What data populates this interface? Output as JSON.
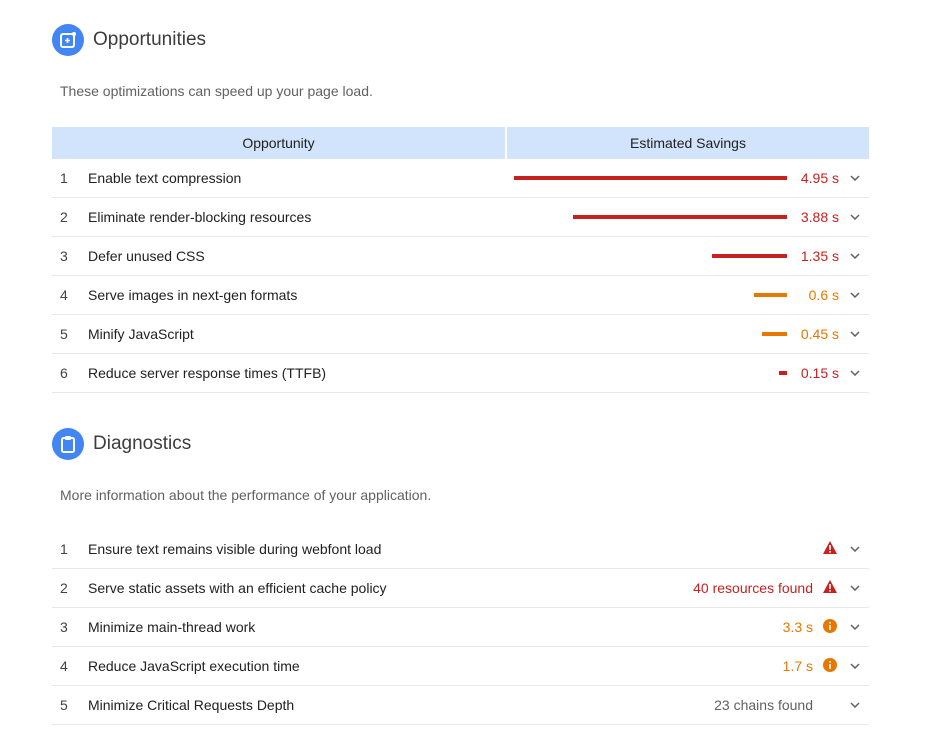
{
  "opportunities": {
    "title": "Opportunities",
    "icon": "sparkle-box-icon",
    "description": "These optimizations can speed up your page load.",
    "headers": [
      "Opportunity",
      "Estimated Savings"
    ],
    "rows": [
      {
        "n": "1",
        "label": "Enable text compression",
        "savings": 4.95,
        "value": "4.95 s",
        "color": "#c5221f"
      },
      {
        "n": "2",
        "label": "Eliminate render-blocking resources",
        "savings": 3.88,
        "value": "3.88 s",
        "color": "#c5221f"
      },
      {
        "n": "3",
        "label": "Defer unused CSS",
        "savings": 1.35,
        "value": "1.35 s",
        "color": "#c5221f"
      },
      {
        "n": "4",
        "label": "Serve images in next-gen formats",
        "savings": 0.6,
        "value": "0.6 s",
        "color": "#e67700"
      },
      {
        "n": "5",
        "label": "Minify JavaScript",
        "savings": 0.45,
        "value": "0.45 s",
        "color": "#e67700"
      },
      {
        "n": "6",
        "label": "Reduce server response times (TTFB)",
        "savings": 0.15,
        "value": "0.15 s",
        "color": "#c5221f"
      }
    ]
  },
  "diagnostics": {
    "title": "Diagnostics",
    "icon": "clipboard-icon",
    "description": "More information about the performance of your application.",
    "rows": [
      {
        "n": "1",
        "label": "Ensure text remains visible during webfont load",
        "value": "",
        "status": "warning",
        "color": "#c5221f"
      },
      {
        "n": "2",
        "label": "Serve static assets with an efficient cache policy",
        "value": "40 resources found",
        "status": "warning",
        "color": "#c5221f"
      },
      {
        "n": "3",
        "label": "Minimize main-thread work",
        "value": "3.3 s",
        "status": "info",
        "color": "#e67700"
      },
      {
        "n": "4",
        "label": "Reduce JavaScript execution time",
        "value": "1.7 s",
        "status": "info",
        "color": "#e67700"
      },
      {
        "n": "5",
        "label": "Minimize Critical Requests Depth",
        "value": "23 chains found",
        "status": "none",
        "color": "#616161"
      }
    ]
  }
}
